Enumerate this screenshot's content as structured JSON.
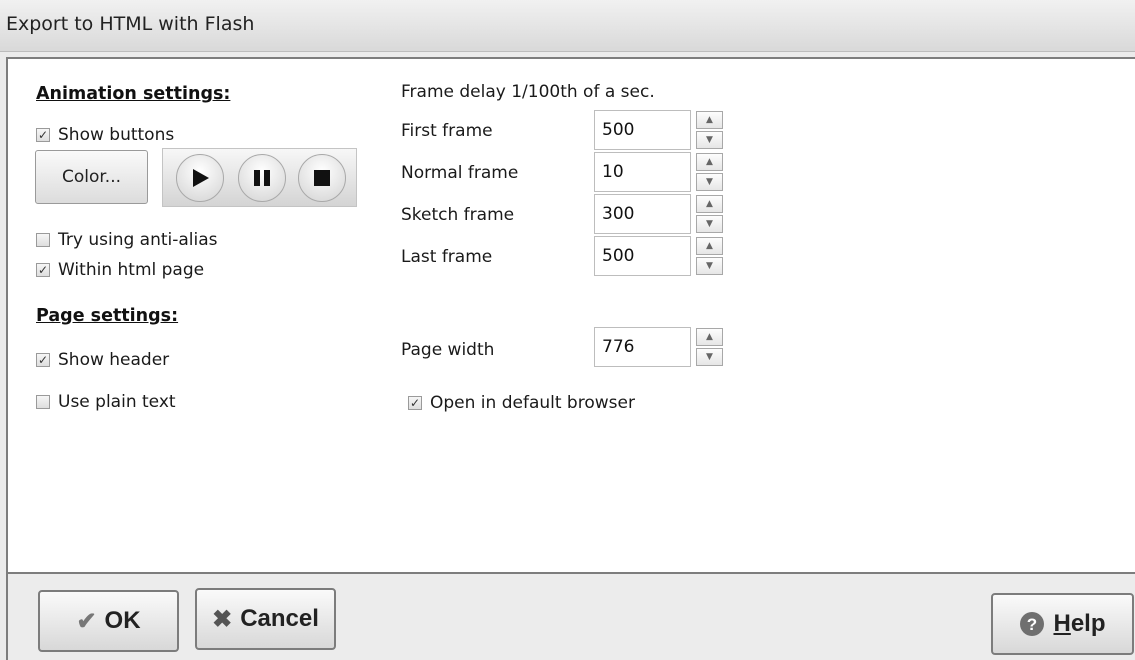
{
  "window": {
    "title": "Export to HTML with Flash"
  },
  "animation": {
    "heading": "Animation settings:",
    "show_buttons": {
      "label": "Show buttons",
      "checked": true
    },
    "color_button": "Color...",
    "player_buttons": [
      "play",
      "pause",
      "stop"
    ],
    "anti_alias": {
      "label": "Try using anti-alias",
      "checked": false
    },
    "within_html": {
      "label": "Within html page",
      "checked": true
    }
  },
  "page": {
    "heading": "Page settings:",
    "show_header": {
      "label": "Show header",
      "checked": true
    },
    "plain_text": {
      "label": "Use plain text",
      "checked": false
    }
  },
  "frame_delay": {
    "heading": "Frame delay 1/100th of a sec.",
    "first": {
      "label": "First frame",
      "value": "500"
    },
    "normal": {
      "label": "Normal frame",
      "value": "10"
    },
    "sketch": {
      "label": "Sketch frame",
      "value": "300"
    },
    "last": {
      "label": "Last frame",
      "value": "500"
    }
  },
  "page_width": {
    "label": "Page width",
    "value": "776"
  },
  "open_browser": {
    "label": "Open in default browser",
    "checked": true
  },
  "buttons": {
    "ok": "OK",
    "cancel": "Cancel",
    "help_prefix": "H",
    "help_rest": "elp"
  },
  "icons": {
    "check": "check-icon",
    "ok": "checkmark-icon",
    "cancel": "cross-icon",
    "help": "help-icon"
  }
}
